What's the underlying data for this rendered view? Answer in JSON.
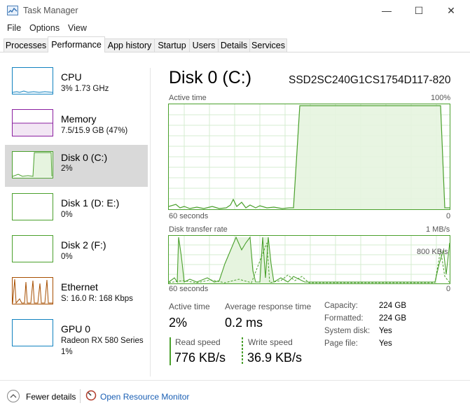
{
  "window": {
    "title": "Task Manager",
    "minimize_glyph": "—",
    "maximize_glyph": "☐",
    "close_glyph": "✕"
  },
  "menu": [
    "File",
    "Options",
    "View"
  ],
  "tabs": [
    {
      "label": "Processes",
      "active": false
    },
    {
      "label": "Performance",
      "active": true
    },
    {
      "label": "App history",
      "active": false
    },
    {
      "label": "Startup",
      "active": false
    },
    {
      "label": "Users",
      "active": false
    },
    {
      "label": "Details",
      "active": false
    },
    {
      "label": "Services",
      "active": false
    }
  ],
  "sidebar": {
    "items": [
      {
        "name": "CPU",
        "detail": "3%  1.73 GHz",
        "color": "#1182c0",
        "selected": false
      },
      {
        "name": "Memory",
        "detail": "7.5/15.9 GB (47%)",
        "color": "#8b1fa0",
        "selected": false
      },
      {
        "name": "Disk 0 (C:)",
        "detail": "2%",
        "color": "#4aa02c",
        "selected": true
      },
      {
        "name": "Disk 1 (D: E:)",
        "detail": "0%",
        "color": "#4aa02c",
        "selected": false
      },
      {
        "name": "Disk 2 (F:)",
        "detail": "0%",
        "color": "#4aa02c",
        "selected": false
      },
      {
        "name": "Ethernet",
        "detail": "S: 16.0  R: 168 Kbps",
        "color": "#a74f01",
        "selected": false
      },
      {
        "name": "GPU 0",
        "detail": "Radeon RX 580 Series",
        "detail2": "1%",
        "color": "#1182c0",
        "selected": false
      }
    ]
  },
  "main": {
    "title": "Disk 0 (C:)",
    "model": "SSD2SC240G1CS1754D117-820",
    "active_graph": {
      "label": "Active time",
      "max": "100%",
      "xlabel": "60 seconds",
      "min": "0"
    },
    "transfer_graph": {
      "label": "Disk transfer rate",
      "max": "1 MB/s",
      "mid": "800 KB/s",
      "xlabel": "60 seconds",
      "min": "0"
    },
    "stats": {
      "active_time_label": "Active time",
      "active_time_value": "2%",
      "avg_response_label": "Average response time",
      "avg_response_value": "0.2 ms",
      "read_label": "Read speed",
      "read_value": "776 KB/s",
      "write_label": "Write speed",
      "write_value": "36.9 KB/s"
    },
    "info": [
      {
        "label": "Capacity:",
        "value": "224 GB"
      },
      {
        "label": "Formatted:",
        "value": "224 GB"
      },
      {
        "label": "System disk:",
        "value": "Yes"
      },
      {
        "label": "Page file:",
        "value": "Yes"
      }
    ]
  },
  "footer": {
    "fewer_details": "Fewer details",
    "open_monitor": "Open Resource Monitor"
  },
  "colors": {
    "disk": "#4aa02c",
    "disk_fill": "#e6f4df",
    "grid": "#d6ecd0",
    "link": "#1a5fb4"
  }
}
